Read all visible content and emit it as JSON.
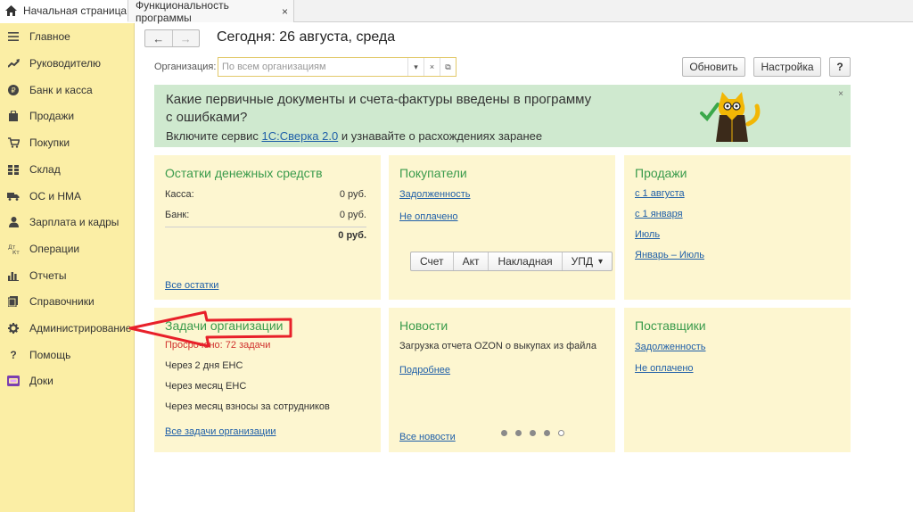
{
  "tabs": [
    {
      "label": "Начальная страница",
      "icon": "home-icon"
    },
    {
      "label": "Функциональность программы",
      "close": "×"
    }
  ],
  "sidebar": {
    "items": [
      {
        "label": "Главное",
        "icon": "menu-icon"
      },
      {
        "label": "Руководителю",
        "icon": "trend-icon"
      },
      {
        "label": "Банк и касса",
        "icon": "coin-icon"
      },
      {
        "label": "Продажи",
        "icon": "bag-icon"
      },
      {
        "label": "Покупки",
        "icon": "cart-icon"
      },
      {
        "label": "Склад",
        "icon": "grid-icon"
      },
      {
        "label": "ОС и НМА",
        "icon": "truck-icon"
      },
      {
        "label": "Зарплата и кадры",
        "icon": "person-icon"
      },
      {
        "label": "Операции",
        "icon": "dt-kt-icon"
      },
      {
        "label": "Отчеты",
        "icon": "bar-chart-icon"
      },
      {
        "label": "Справочники",
        "icon": "book-icon"
      },
      {
        "label": "Администрирование",
        "icon": "gear-icon"
      },
      {
        "label": "Помощь",
        "icon": "question-icon"
      },
      {
        "label": "Доки",
        "icon": "docs-icon"
      }
    ]
  },
  "header": {
    "title": "Сегодня: 26 августа, среда",
    "back": "←",
    "forward": "→"
  },
  "org": {
    "label": "Организация:",
    "placeholder": "По всем организациям",
    "dropdown": "▾",
    "clear": "×",
    "open": "⧉"
  },
  "toolbar": {
    "refresh": "Обновить",
    "settings": "Настройка",
    "help": "?"
  },
  "banner": {
    "line1": "Какие первичные документы и счета-фактуры введены в программу",
    "line2": "с ошибками?",
    "line3_prefix": "Включите сервис ",
    "line3_link": "1С:Сверка 2.0",
    "line3_suffix": " и узнавайте о расхождениях заранее",
    "close": "×"
  },
  "cards": {
    "cash": {
      "title": "Остатки денежных средств",
      "kassa_label": "Касса:",
      "kassa_value": "0 руб.",
      "bank_label": "Банк:",
      "bank_value": "0 руб.",
      "total_value": "0 руб.",
      "link": "Все остатки"
    },
    "buyers": {
      "title": "Покупатели",
      "link1": "Задолженность",
      "link2": "Не оплачено",
      "buttons": [
        "Счет",
        "Акт",
        "Накладная",
        "УПД"
      ],
      "upd_arrow": "▾"
    },
    "sales": {
      "title": "Продажи",
      "links": [
        "с 1 августа",
        "с 1 января",
        "Июль",
        "Январь – Июль"
      ]
    },
    "tasks": {
      "title": "Задачи организации",
      "overdue": "Просрочено: 72 задачи",
      "items": [
        "Через 2 дня ЕНС",
        "Через месяц ЕНС",
        "Через месяц взносы за сотрудников"
      ],
      "link": "Все задачи организации"
    },
    "news": {
      "title": "Новости",
      "text": "Загрузка отчета OZON о выкупах из файла",
      "more": "Подробнее",
      "all": "Все новости"
    },
    "suppliers": {
      "title": "Поставщики",
      "link1": "Задолженность",
      "link2": "Не оплачено"
    }
  },
  "colors": {
    "sidebar_bg": "#fbeea5",
    "card_bg": "#fdf6d0",
    "banner_bg": "#cfe9cf",
    "card_title": "#3a9b4c",
    "link": "#1f5fa8",
    "overdue": "#d0312d",
    "arrow": "#e8202a"
  }
}
